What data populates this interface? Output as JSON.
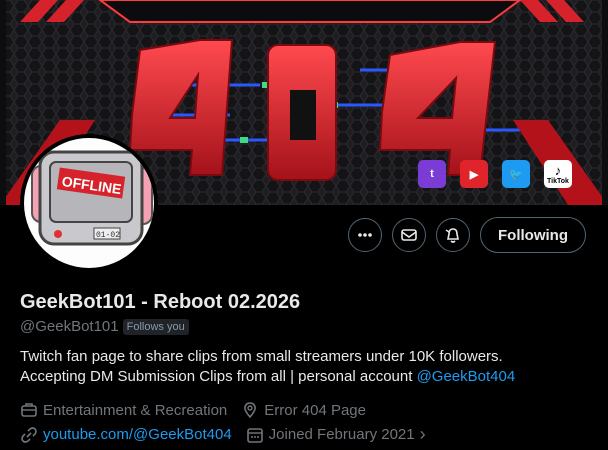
{
  "banner": {
    "title_art": "404",
    "socials": [
      {
        "name": "twitch",
        "glyph": "t"
      },
      {
        "name": "youtube",
        "glyph": "▶"
      },
      {
        "name": "twitter",
        "glyph": "🐦"
      },
      {
        "name": "tiktok",
        "glyph": "♪",
        "label": "TikTok"
      }
    ]
  },
  "avatar": {
    "screen_text": "OFFLINE",
    "tag_text": "01-02"
  },
  "actions": {
    "follow_label": "Following"
  },
  "profile": {
    "name": "GeekBot101 - Reboot 02.2026",
    "handle": "@GeekBot101",
    "follows_you": "Follows you",
    "bio_line1": "Twitch fan page to share clips from small streamers under 10K followers.",
    "bio_line2": "Accepting DM Submission Clips from all | personal account ",
    "bio_mention": "@GeekBot404",
    "category": "Entertainment & Recreation",
    "location": "Error 404 Page",
    "website": "youtube.com/@GeekBot404",
    "joined": "Joined February 2021",
    "joined_chevron": "›"
  },
  "colors": {
    "accent": "#1d9bf0",
    "background": "#000000",
    "muted": "#71767b",
    "banner_red": "#d6232b"
  }
}
